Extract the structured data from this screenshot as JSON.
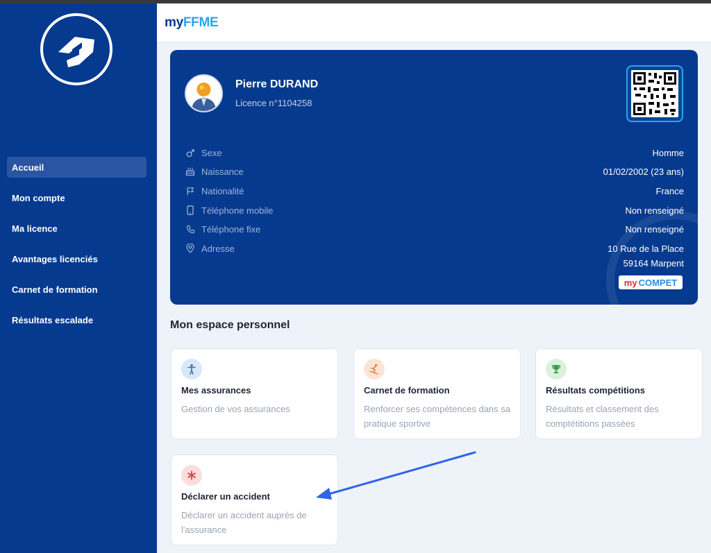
{
  "app": {
    "brand_part1": "my",
    "brand_part2": "FFME"
  },
  "sidebar": {
    "items": [
      {
        "label": "Accueil",
        "active": true
      },
      {
        "label": "Mon compte"
      },
      {
        "label": "Ma licence"
      },
      {
        "label": "Avantages licenciés"
      },
      {
        "label": "Carnet de formation"
      },
      {
        "label": "Résultats escalade"
      }
    ]
  },
  "profile": {
    "name": "Pierre DURAND",
    "licence": "Licence n°1104258",
    "fields": [
      {
        "icon": "male-gender-icon",
        "label": "Sexe",
        "value": "Homme"
      },
      {
        "icon": "birthday-cake-icon",
        "label": "Naissance",
        "value": "01/02/2002 (23 ans)"
      },
      {
        "icon": "flag-icon",
        "label": "Nationalité",
        "value": "France"
      },
      {
        "icon": "mobile-phone-icon",
        "label": "Téléphone mobile",
        "value": "Non renseigné"
      },
      {
        "icon": "phone-icon",
        "label": "Téléphone fixe",
        "value": "Non renseigné"
      },
      {
        "icon": "location-pin-icon",
        "label": "Adresse",
        "value_line1": "10 Rue de la Place",
        "value_line2": "59164 Marpent"
      }
    ],
    "badge_my": "my",
    "badge_compet": "COMPET"
  },
  "section": {
    "title": "Mon espace personnel"
  },
  "tiles": [
    {
      "title": "Mes assurances",
      "desc": "Gestion de vos assurances",
      "icon": "person-icon",
      "color": "#d7e8fa"
    },
    {
      "title": "Carnet de formation",
      "desc": "Renforcer ses compétences dans sa pratique sportive",
      "icon": "skier-icon",
      "color": "#fde4d4"
    },
    {
      "title": "Résultats compétitions",
      "desc": "Résultats et classement des comptétitions passées",
      "icon": "trophy-icon",
      "color": "#daf2dc"
    },
    {
      "title": "Déclarer un accident",
      "desc": "Déclarer un accident auprès de l'assurance",
      "icon": "asterisk-icon",
      "color": "#fddcdc"
    }
  ],
  "colors": {
    "primary": "#063a8f",
    "accent": "#2aa6e8",
    "arrow": "#2f63e8"
  }
}
